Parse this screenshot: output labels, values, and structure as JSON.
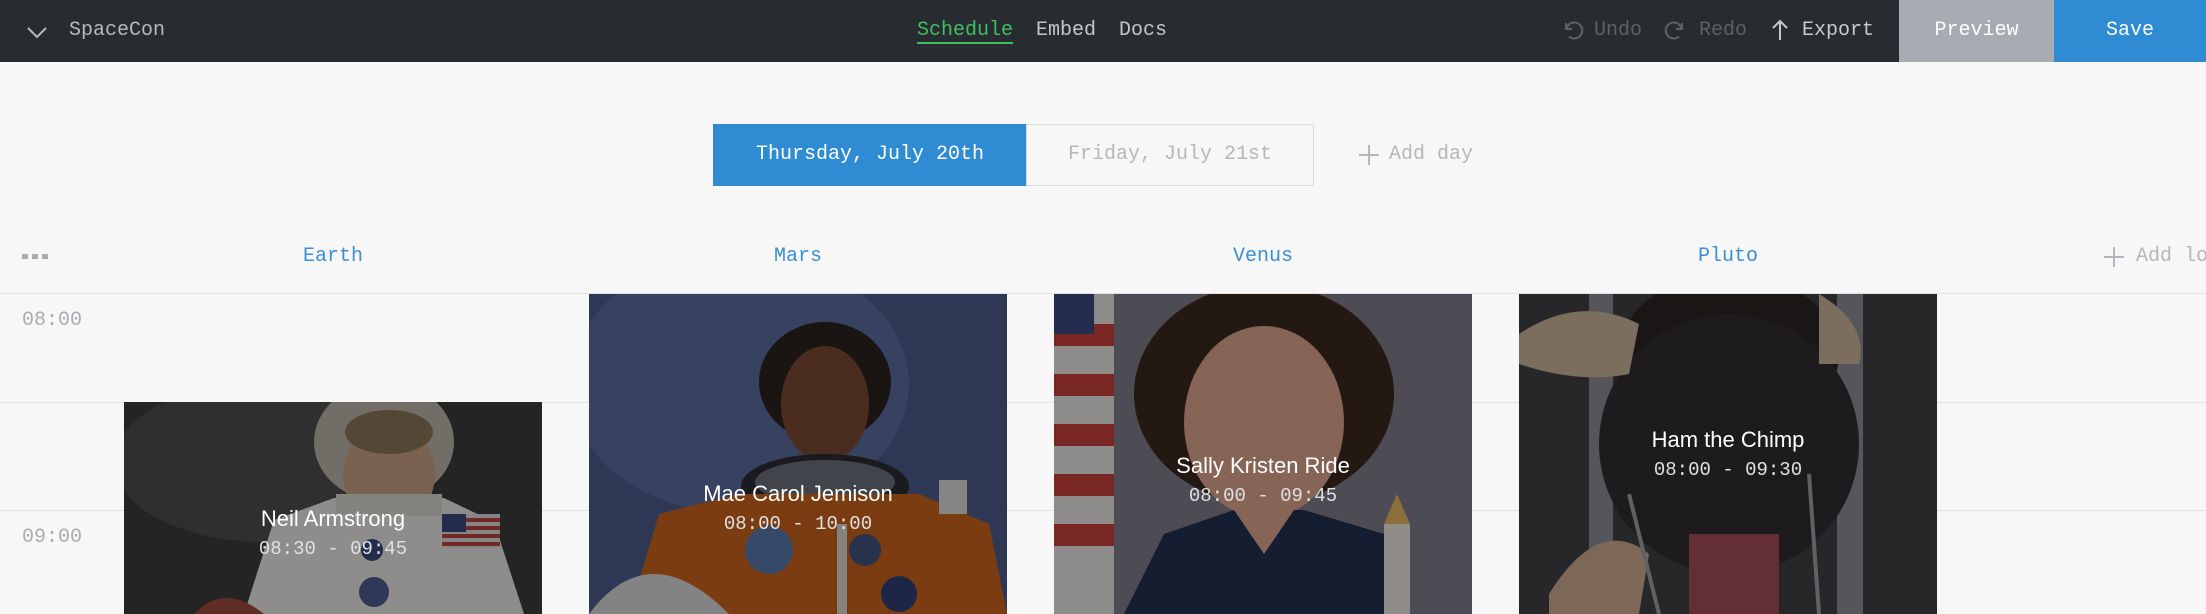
{
  "app": {
    "title": "SpaceCon"
  },
  "nav": {
    "items": [
      "Schedule",
      "Embed",
      "Docs"
    ],
    "active": "Schedule"
  },
  "toolbar": {
    "undo_label": "Undo",
    "redo_label": "Redo",
    "export_label": "Export",
    "preview_label": "Preview",
    "save_label": "Save"
  },
  "days": {
    "items": [
      "Thursday, July 20th",
      "Friday, July 21st"
    ],
    "active": "Thursday, July 20th",
    "add_label": "Add day"
  },
  "locations": {
    "items": [
      "Earth",
      "Mars",
      "Venus",
      "Pluto"
    ],
    "add_label": "Add location"
  },
  "times": [
    "08:00",
    "09:00"
  ],
  "sessions": [
    {
      "name": "Neil Armstrong",
      "time": "08:30 - 09:45",
      "location": "Earth"
    },
    {
      "name": "Mae Carol Jemison",
      "time": "08:00 - 10:00",
      "location": "Mars"
    },
    {
      "name": "Sally Kristen Ride",
      "time": "08:00 - 09:45",
      "location": "Venus"
    },
    {
      "name": "Ham the Chimp",
      "time": "08:00 - 09:30",
      "location": "Pluto"
    }
  ],
  "colors": {
    "topbar": "#282c31",
    "accent_blue": "#2f8bd2",
    "active_nav_green": "#3fbf62",
    "preview_gray": "#a7abb2"
  },
  "icons": {
    "menu_toggle": "chevron-down-icon",
    "undo": "undo-icon",
    "redo": "redo-icon",
    "export": "arrow-up-icon",
    "add": "plus-icon",
    "more": "more-horizontal-icon"
  }
}
